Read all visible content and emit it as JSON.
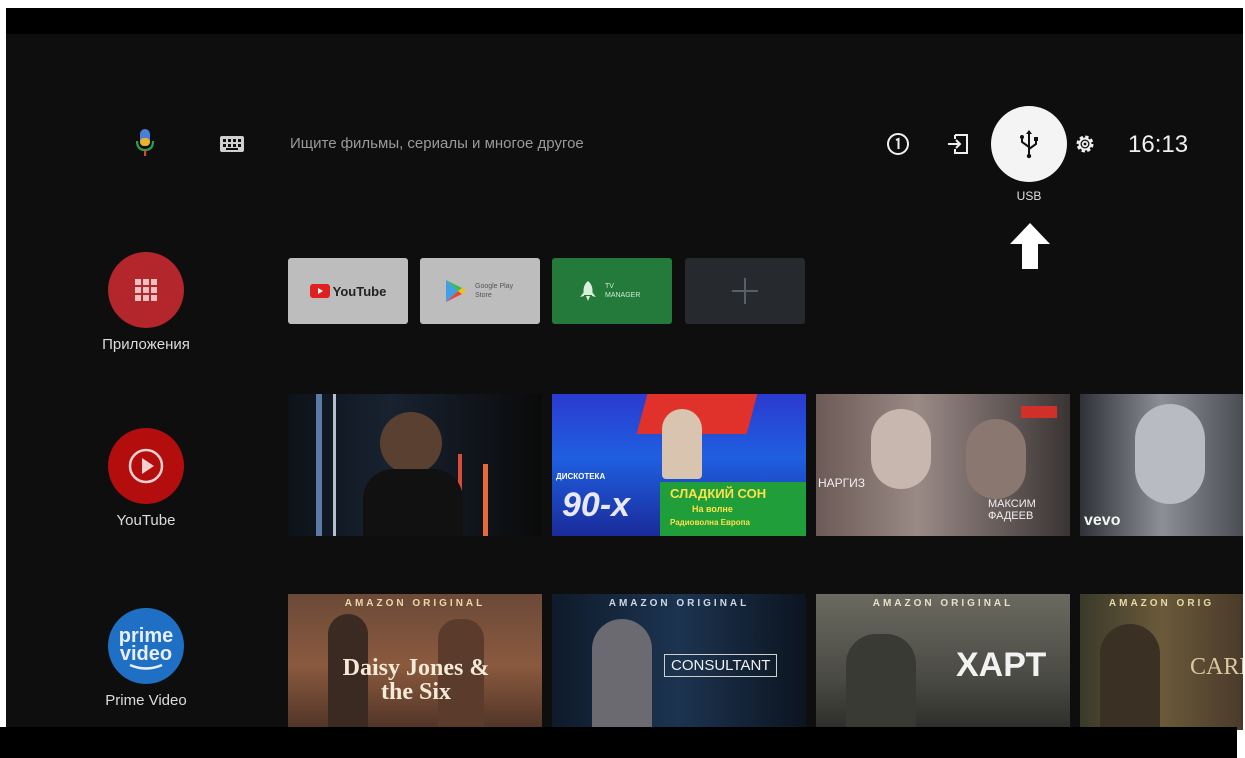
{
  "search": {
    "placeholder": "Ищите фильмы, сериалы и многое другое"
  },
  "status": {
    "clock": "16:13",
    "focused_label": "USB"
  },
  "icons": [
    "mic-icon",
    "keyboard-icon",
    "info-icon",
    "input-icon",
    "usb-icon",
    "gear-icon"
  ],
  "rail": [
    {
      "label": "Приложения",
      "color": "#b3262b"
    },
    {
      "label": "YouTube",
      "color": "#b30d0d"
    },
    {
      "label": "Prime Video",
      "color": "#1f6fc4"
    }
  ],
  "favorites": [
    {
      "label": "YouTube"
    },
    {
      "label": "Google Play Store"
    },
    {
      "label": "TV MANAGER"
    }
  ],
  "youtube_row": [
    {
      "title": ""
    },
    {
      "title": "СЛАДКИЙ СОН",
      "badge": "ДИСКОТЕКА",
      "number": "90-х",
      "line2": "На волне",
      "line3": "Радиоволна Европа"
    },
    {
      "title": "НАРГИЗ",
      "title2": "МАКСИМ ФАДЕЕВ"
    },
    {
      "title": "vevo"
    }
  ],
  "prime_row": [
    {
      "badge": "AMAZON ORIGINAL",
      "title": "Daisy Jones & the Six"
    },
    {
      "badge": "AMAZON ORIGINAL",
      "title": "CONSULTANT"
    },
    {
      "badge": "AMAZON ORIGINAL",
      "title": "ХАРТ"
    },
    {
      "badge": "AMAZON ORIG",
      "title": "CARN"
    }
  ]
}
